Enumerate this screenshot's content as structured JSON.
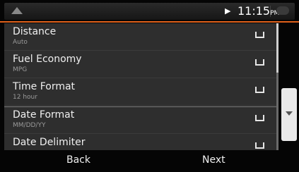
{
  "status": {
    "title": "",
    "arrow": "▶",
    "time": "11:15",
    "ampm": "PM"
  },
  "list": {
    "items": [
      {
        "label": "Distance",
        "sub": "Auto"
      },
      {
        "label": "Fuel Economy",
        "sub": "MPG"
      },
      {
        "label": "Time Format",
        "sub": "12 hour"
      },
      {
        "label": "Date Format",
        "sub": "MM/DD/YY"
      },
      {
        "label": "Date Delimiter",
        "sub": ""
      }
    ]
  },
  "bottom": {
    "back": "Back",
    "next": "Next"
  }
}
